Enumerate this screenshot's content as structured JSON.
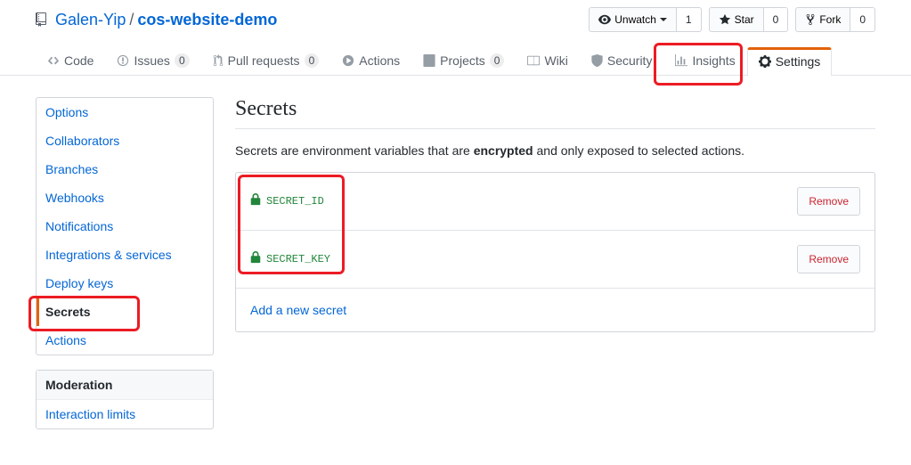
{
  "breadcrumb": {
    "owner": "Galen-Yip",
    "repo": "cos-website-demo"
  },
  "watch": {
    "label": "Unwatch",
    "count": "1"
  },
  "star": {
    "label": "Star",
    "count": "0"
  },
  "fork": {
    "label": "Fork",
    "count": "0"
  },
  "tabs": {
    "code": "Code",
    "issues": {
      "label": "Issues",
      "count": "0"
    },
    "pulls": {
      "label": "Pull requests",
      "count": "0"
    },
    "actions": "Actions",
    "projects": {
      "label": "Projects",
      "count": "0"
    },
    "wiki": "Wiki",
    "security": "Security",
    "insights": "Insights",
    "settings": "Settings"
  },
  "sidebar": {
    "items": [
      "Options",
      "Collaborators",
      "Branches",
      "Webhooks",
      "Notifications",
      "Integrations & services",
      "Deploy keys",
      "Secrets",
      "Actions"
    ],
    "moderation_heading": "Moderation",
    "moderation_items": [
      "Interaction limits"
    ]
  },
  "page": {
    "title": "Secrets",
    "description_pre": "Secrets are environment variables that are ",
    "description_bold": "encrypted",
    "description_post": " and only exposed to selected actions.",
    "add_new": "Add a new secret"
  },
  "secrets": [
    {
      "name": "SECRET_ID",
      "remove": "Remove"
    },
    {
      "name": "SECRET_KEY",
      "remove": "Remove"
    }
  ]
}
